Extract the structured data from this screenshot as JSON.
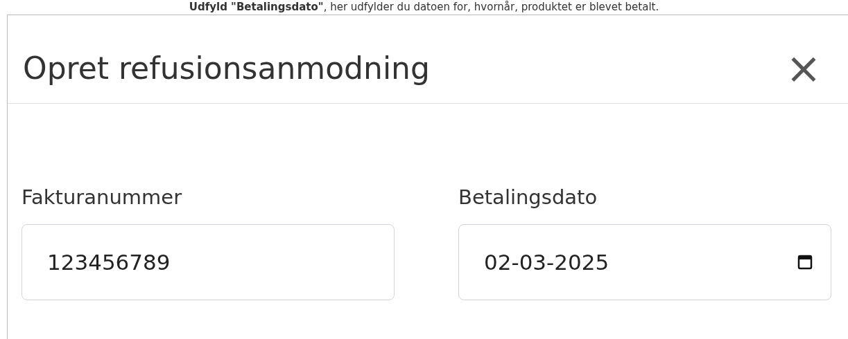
{
  "caption": "**Udfyld \"Betalingsdato\"**, her udfylder du datoen for, hvornår, produktet er blevet betalt.",
  "dialog": {
    "title": "Opret refusionsanmodning",
    "close": "×"
  },
  "fields": [
    {
      "label": "Fakturanummer",
      "value": "123456789",
      "kind": "text"
    },
    {
      "label": "Betalingsdato",
      "value": "02-03-2025",
      "kind": "date"
    }
  ]
}
